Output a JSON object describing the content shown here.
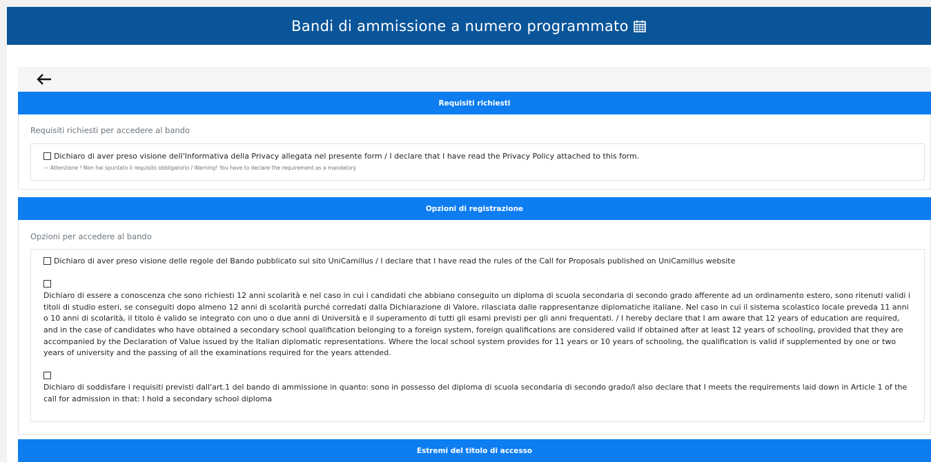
{
  "header": {
    "title": "Bandi di ammissione a numero programmato",
    "icon": "calendar-icon"
  },
  "back": {
    "icon": "arrow-left-icon"
  },
  "sections": {
    "requisiti": {
      "title": "Requisiti richiesti",
      "subtitle": "Requisiti richiesti per accedere al bando",
      "items": [
        {
          "label": "Dichiaro di aver preso visione dell'Informativa della Privacy allegata nel presente form / I declare that I have read the Privacy Policy attached to this form.",
          "warning": "— Attenzione ! Non hai spuntato il requisito obbligatorio / Warning! You have to declare the requirement as a mandatory",
          "checked": false
        }
      ]
    },
    "opzioni": {
      "title": "Opzioni di registrazione",
      "subtitle": "Opzioni per accedere al bando",
      "items": [
        {
          "label": "Dichiaro di aver preso visione delle regole del Bando pubblicato sul sito UniCamillus / I declare that I have read the rules of the Call for Proposals published on UniCamillus website",
          "checked": false
        },
        {
          "label": "Dichiaro di essere a conoscenza che sono richiesti 12 anni scolarità e nel caso in cui i candidati che abbiano conseguito un diploma di scuola secondaria di secondo grado afferente ad un ordinamento estero, sono ritenuti validi i titoli di studio esteri, se conseguiti dopo almeno 12 anni di scolarità purché corredati dalla Dichiarazione di Valore, rilasciata dalle rappresentanze diplomatiche italiane. Nel caso in cui il sistema scolastico locale preveda 11 anni o 10 anni di scolarità, il titolo è valido se integrato con uno o due anni di Università e il superamento di tutti gli esami previsti per gli anni frequentati. / I hereby declare that I am aware that 12 years of education are required, and in the case of candidates who have obtained a secondary school qualification belonging to a foreign system, foreign qualifications are considered valid if obtained after at least 12 years of schooling, provided that they are accompanied by the Declaration of Value issued by the Italian diplomatic representations. Where the local school system provides for 11 years or 10 years of schooling, the qualification is valid if supplemented by one or two years of university and the passing of all the examinations required for the years attended.",
          "checked": false
        },
        {
          "label": "Dichiaro di soddisfare i requisiti previsti dall'art.1 del bando di ammissione in quanto: sono in possesso del diploma di scuola secondaria di secondo grado/I also declare that I meets the requirements laid down in Article 1 of the call for admission in that: I hold a secondary school diploma",
          "checked": false
        }
      ]
    },
    "estremi": {
      "title": "Estremi del titolo di accesso"
    }
  },
  "colors": {
    "topbar": "#0a5599",
    "section_header": "#0d7df0"
  }
}
